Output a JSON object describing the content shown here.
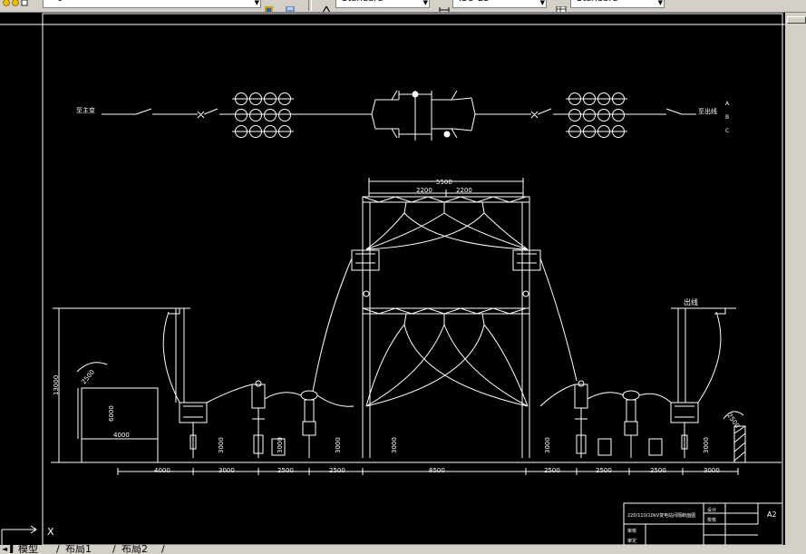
{
  "toolbar": {
    "layer_value": "0",
    "text_style": "Standard",
    "dim_style": "ISO-25",
    "table_style": "Standard"
  },
  "drawing": {
    "label_left_line": "至主变",
    "label_right_line": "至出线",
    "phase_labels": [
      "A",
      "B",
      "C"
    ],
    "gantry_width_dim": "5500",
    "gantry_sub_dims": [
      "2200",
      "2200"
    ],
    "height_dim": "13000",
    "height_dim_2": "6000",
    "width_dim_box": "4000",
    "clearance_left": "2500",
    "clearance_right": "2500",
    "outgoing_label": "出线",
    "equipment_heights": [
      "3000",
      "3000",
      "3000",
      "3000",
      "3000",
      "3000"
    ],
    "bottom_dims": [
      "4000",
      "3000",
      "2500",
      "2500",
      "8500",
      "2500",
      "2500",
      "2500",
      "3000"
    ],
    "title_block": {
      "name": "220/110/10kV变电站间隔断面图",
      "sheet_size": "A2",
      "cell_1": "设计",
      "cell_2": "校核",
      "cell_3": "审核",
      "cell_4": "审定"
    }
  },
  "command": {
    "ucs_label": "X"
  },
  "layout_tabs": [
    "模型",
    "布局1",
    "布局2"
  ]
}
